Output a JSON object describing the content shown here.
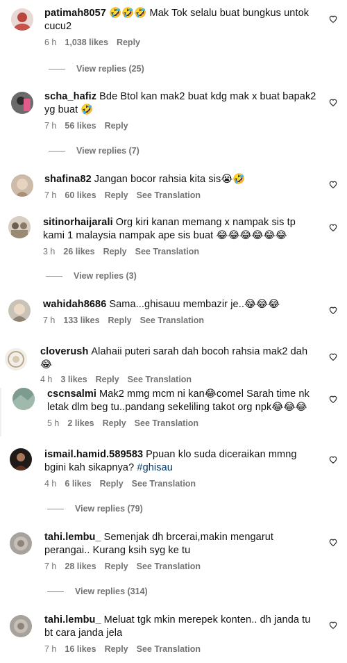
{
  "comments": [
    {
      "user": "patimah8057",
      "text": "🤣🤣🤣 Mak Tok selalu buat bungkus untok cucu2",
      "time": "6 h",
      "likes": "1,038 likes",
      "reply": "Reply",
      "view_replies": "View replies (25)"
    },
    {
      "user": "scha_hafiz",
      "text": "Bde Btol kan mak2 buat kdg mak x buat bapak2 yg buat 🤣",
      "time": "7 h",
      "likes": "56 likes",
      "reply": "Reply",
      "view_replies": "View replies (7)"
    },
    {
      "user": "shafina82",
      "text": "Jangan bocor rahsia kita sis😭🤣",
      "time": "7 h",
      "likes": "60 likes",
      "reply": "Reply",
      "translate": "See Translation"
    },
    {
      "user": "sitinorhaijarali",
      "text": "Org kiri kanan memang x nampak sis tp kami 1 malaysia nampak ape sis buat 😂😂😂😂😂😂",
      "time": "3 h",
      "likes": "26 likes",
      "reply": "Reply",
      "translate": "See Translation",
      "view_replies": "View replies (3)"
    },
    {
      "user": "wahidah8686",
      "text": "Sama...ghisauu membazir je..😂😂😂",
      "time": "7 h",
      "likes": "133 likes",
      "reply": "Reply",
      "translate": "See Translation"
    },
    {
      "user": "cloverush",
      "text": "Alahaii puteri sarah dah bocoh rahsia mak2 dah 😂",
      "time": "4 h",
      "likes": "3 likes",
      "reply": "Reply",
      "translate": "See Translation"
    },
    {
      "user": "cscnsalmi",
      "text": "Mak2 mmg mcm ni kan😂comel Sarah time nk letak dlm beg tu..pandang sekeliling takot org npk😂😂😂",
      "time": "5 h",
      "likes": "2 likes",
      "reply": "Reply",
      "translate": "See Translation"
    },
    {
      "user": "ismail.hamid.589583",
      "text": "Ppuan klo suda diceraikan mmng bgini kah sikapnya?",
      "hashtag": "#ghisau",
      "time": "4 h",
      "likes": "6 likes",
      "reply": "Reply",
      "translate": "See Translation",
      "view_replies": "View replies (79)"
    },
    {
      "user": "tahi.lembu_",
      "text": "Semenjak dh brcerai,makin mengarut perangai.. Kurang ksih syg ke tu",
      "time": "7 h",
      "likes": "28 likes",
      "reply": "Reply",
      "translate": "See Translation",
      "view_replies": "View replies (314)"
    },
    {
      "user": "tahi.lembu_",
      "text": "Meluat tgk mkin merepek konten.. dh janda tu bt cara janda jela",
      "time": "7 h",
      "likes": "16 likes",
      "reply": "Reply",
      "translate": "See Translation"
    }
  ],
  "colors": {
    "meta": "#737373",
    "hashtag": "#00376b",
    "text": "#111111"
  }
}
